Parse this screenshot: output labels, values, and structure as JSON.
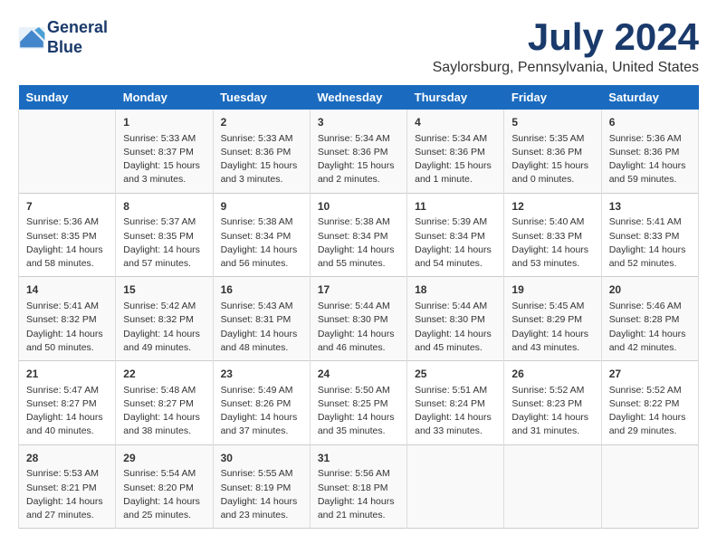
{
  "logo": {
    "line1": "General",
    "line2": "Blue"
  },
  "title": "July 2024",
  "location": "Saylorsburg, Pennsylvania, United States",
  "days_of_week": [
    "Sunday",
    "Monday",
    "Tuesday",
    "Wednesday",
    "Thursday",
    "Friday",
    "Saturday"
  ],
  "weeks": [
    [
      {
        "day": "",
        "content": ""
      },
      {
        "day": "1",
        "content": "Sunrise: 5:33 AM\nSunset: 8:37 PM\nDaylight: 15 hours\nand 3 minutes."
      },
      {
        "day": "2",
        "content": "Sunrise: 5:33 AM\nSunset: 8:36 PM\nDaylight: 15 hours\nand 3 minutes."
      },
      {
        "day": "3",
        "content": "Sunrise: 5:34 AM\nSunset: 8:36 PM\nDaylight: 15 hours\nand 2 minutes."
      },
      {
        "day": "4",
        "content": "Sunrise: 5:34 AM\nSunset: 8:36 PM\nDaylight: 15 hours\nand 1 minute."
      },
      {
        "day": "5",
        "content": "Sunrise: 5:35 AM\nSunset: 8:36 PM\nDaylight: 15 hours\nand 0 minutes."
      },
      {
        "day": "6",
        "content": "Sunrise: 5:36 AM\nSunset: 8:36 PM\nDaylight: 14 hours\nand 59 minutes."
      }
    ],
    [
      {
        "day": "7",
        "content": "Sunrise: 5:36 AM\nSunset: 8:35 PM\nDaylight: 14 hours\nand 58 minutes."
      },
      {
        "day": "8",
        "content": "Sunrise: 5:37 AM\nSunset: 8:35 PM\nDaylight: 14 hours\nand 57 minutes."
      },
      {
        "day": "9",
        "content": "Sunrise: 5:38 AM\nSunset: 8:34 PM\nDaylight: 14 hours\nand 56 minutes."
      },
      {
        "day": "10",
        "content": "Sunrise: 5:38 AM\nSunset: 8:34 PM\nDaylight: 14 hours\nand 55 minutes."
      },
      {
        "day": "11",
        "content": "Sunrise: 5:39 AM\nSunset: 8:34 PM\nDaylight: 14 hours\nand 54 minutes."
      },
      {
        "day": "12",
        "content": "Sunrise: 5:40 AM\nSunset: 8:33 PM\nDaylight: 14 hours\nand 53 minutes."
      },
      {
        "day": "13",
        "content": "Sunrise: 5:41 AM\nSunset: 8:33 PM\nDaylight: 14 hours\nand 52 minutes."
      }
    ],
    [
      {
        "day": "14",
        "content": "Sunrise: 5:41 AM\nSunset: 8:32 PM\nDaylight: 14 hours\nand 50 minutes."
      },
      {
        "day": "15",
        "content": "Sunrise: 5:42 AM\nSunset: 8:32 PM\nDaylight: 14 hours\nand 49 minutes."
      },
      {
        "day": "16",
        "content": "Sunrise: 5:43 AM\nSunset: 8:31 PM\nDaylight: 14 hours\nand 48 minutes."
      },
      {
        "day": "17",
        "content": "Sunrise: 5:44 AM\nSunset: 8:30 PM\nDaylight: 14 hours\nand 46 minutes."
      },
      {
        "day": "18",
        "content": "Sunrise: 5:44 AM\nSunset: 8:30 PM\nDaylight: 14 hours\nand 45 minutes."
      },
      {
        "day": "19",
        "content": "Sunrise: 5:45 AM\nSunset: 8:29 PM\nDaylight: 14 hours\nand 43 minutes."
      },
      {
        "day": "20",
        "content": "Sunrise: 5:46 AM\nSunset: 8:28 PM\nDaylight: 14 hours\nand 42 minutes."
      }
    ],
    [
      {
        "day": "21",
        "content": "Sunrise: 5:47 AM\nSunset: 8:27 PM\nDaylight: 14 hours\nand 40 minutes."
      },
      {
        "day": "22",
        "content": "Sunrise: 5:48 AM\nSunset: 8:27 PM\nDaylight: 14 hours\nand 38 minutes."
      },
      {
        "day": "23",
        "content": "Sunrise: 5:49 AM\nSunset: 8:26 PM\nDaylight: 14 hours\nand 37 minutes."
      },
      {
        "day": "24",
        "content": "Sunrise: 5:50 AM\nSunset: 8:25 PM\nDaylight: 14 hours\nand 35 minutes."
      },
      {
        "day": "25",
        "content": "Sunrise: 5:51 AM\nSunset: 8:24 PM\nDaylight: 14 hours\nand 33 minutes."
      },
      {
        "day": "26",
        "content": "Sunrise: 5:52 AM\nSunset: 8:23 PM\nDaylight: 14 hours\nand 31 minutes."
      },
      {
        "day": "27",
        "content": "Sunrise: 5:52 AM\nSunset: 8:22 PM\nDaylight: 14 hours\nand 29 minutes."
      }
    ],
    [
      {
        "day": "28",
        "content": "Sunrise: 5:53 AM\nSunset: 8:21 PM\nDaylight: 14 hours\nand 27 minutes."
      },
      {
        "day": "29",
        "content": "Sunrise: 5:54 AM\nSunset: 8:20 PM\nDaylight: 14 hours\nand 25 minutes."
      },
      {
        "day": "30",
        "content": "Sunrise: 5:55 AM\nSunset: 8:19 PM\nDaylight: 14 hours\nand 23 minutes."
      },
      {
        "day": "31",
        "content": "Sunrise: 5:56 AM\nSunset: 8:18 PM\nDaylight: 14 hours\nand 21 minutes."
      },
      {
        "day": "",
        "content": ""
      },
      {
        "day": "",
        "content": ""
      },
      {
        "day": "",
        "content": ""
      }
    ]
  ]
}
